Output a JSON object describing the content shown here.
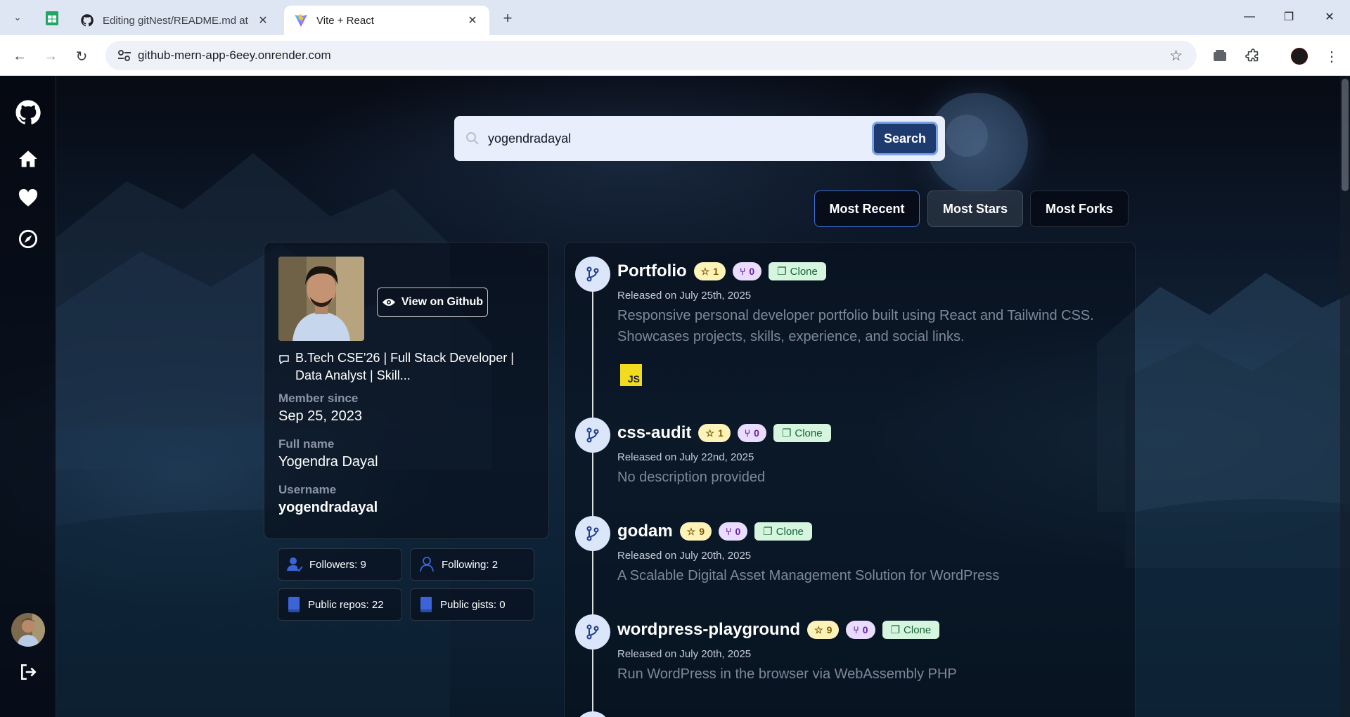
{
  "browser": {
    "tabs": [
      {
        "title": "Editing gitNest/README.md at",
        "icon": "github-icon"
      },
      {
        "title": "Vite + React",
        "icon": "vite-icon"
      }
    ],
    "url": "github-mern-app-6eey.onrender.com"
  },
  "search": {
    "value": "yogendradayal",
    "button_label": "Search"
  },
  "sort": {
    "options": [
      "Most Recent",
      "Most Stars",
      "Most Forks"
    ],
    "active": "Most Recent"
  },
  "profile": {
    "view_button": "View on Github",
    "bio": "B.Tech CSE'26 | Full Stack Developer | Data Analyst | Skill...",
    "member_since_label": "Member since",
    "member_since": "Sep 25, 2023",
    "full_name_label": "Full name",
    "full_name": "Yogendra Dayal",
    "username_label": "Username",
    "username": "yogendradayal"
  },
  "stats": {
    "followers": "Followers: 9",
    "following": "Following: 2",
    "public_repos": "Public repos: 22",
    "public_gists": "Public gists: 0"
  },
  "repos": [
    {
      "name": "Portfolio",
      "stars": "1",
      "forks": "0",
      "clone": "Clone",
      "released": "Released on July 25th, 2025",
      "description": "Responsive personal developer portfolio built using React and Tailwind CSS. Showcases projects, skills, experience, and social links.",
      "language": "JS"
    },
    {
      "name": "css-audit",
      "stars": "1",
      "forks": "0",
      "clone": "Clone",
      "released": "Released on July 22nd, 2025",
      "description": "No description provided"
    },
    {
      "name": "godam",
      "stars": "9",
      "forks": "0",
      "clone": "Clone",
      "released": "Released on July 20th, 2025",
      "description": "A Scalable Digital Asset Management Solution for WordPress"
    },
    {
      "name": "wordpress-playground",
      "stars": "9",
      "forks": "0",
      "clone": "Clone",
      "released": "Released on July 20th, 2025",
      "description": "Run WordPress in the browser via WebAssembly PHP"
    }
  ],
  "colors": {
    "accent": "#1d3b6f",
    "active_border": "#3f6fd4",
    "star_badge": "#fdf2b8",
    "fork_badge": "#eadcff",
    "clone_badge": "#d5f5df"
  }
}
